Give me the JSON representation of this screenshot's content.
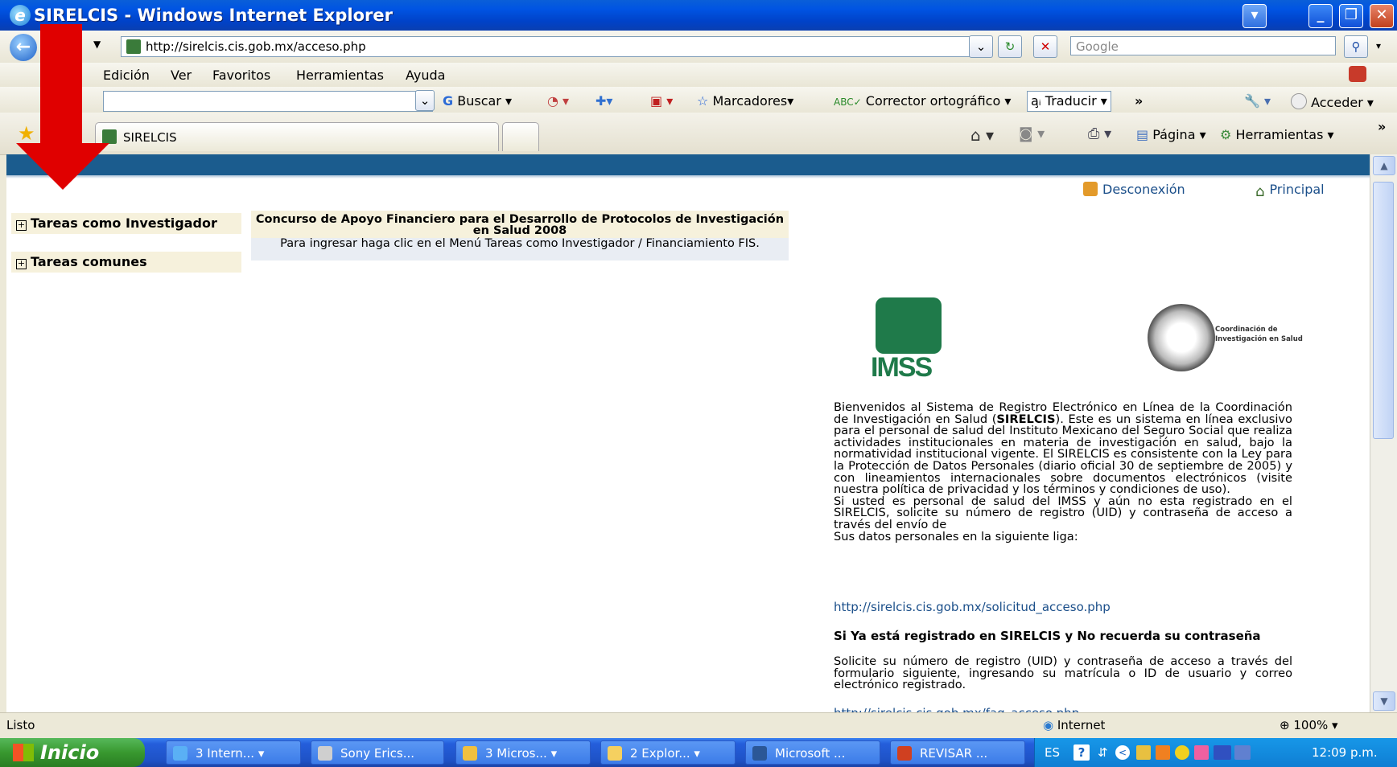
{
  "window": {
    "title": "SIRELCIS - Windows Internet Explorer"
  },
  "address": {
    "url": "http://sirelcis.cis.gob.mx/acceso.php"
  },
  "search": {
    "placeholder": "Google"
  },
  "menu": {
    "items": [
      "Edición",
      "Ver",
      "Favoritos",
      "Herramientas",
      "Ayuda"
    ]
  },
  "google_toolbar": {
    "buscar": "Buscar",
    "marcadores": "Marcadores",
    "corrector": "Corrector ortográfico",
    "traducir": "Traducir",
    "acceder": "Acceder",
    "more": "»"
  },
  "tabs": {
    "active": "SIRELCIS"
  },
  "command_bar": {
    "pagina": "Página",
    "herramientas": "Herramientas",
    "more": "»"
  },
  "page": {
    "desconexion": "Desconexión",
    "principal": "Principal",
    "sidebar": [
      "Tareas como Investigador",
      "Tareas comunes"
    ],
    "notice_title": "Concurso de Apoyo Financiero para el Desarrollo de Protocolos de Investigación en Salud 2008",
    "notice_body": "Para ingresar haga clic en el Menú Tareas como Investigador / Financiamiento FIS.",
    "logo_imss": "IMSS",
    "logo_cis": "Coordinación de Investigación en Salud",
    "welcome_a": "Bienvenidos al Sistema de Registro Electrónico en Línea de la Coordinación de Investigación en Salud (",
    "welcome_bold": "SIRELCIS",
    "welcome_b": "). Este es un sistema en línea exclusivo para el personal de salud del Instituto Mexicano del Seguro Social que realiza actividades institucionales en materia de investigación en salud, bajo la normatividad institucional vigente. El SIRELCIS es consistente con la Ley para la Protección de Datos Personales (diario oficial 30 de septiembre de 2005) y con lineamientos internacionales sobre documentos electrónicos (visite nuestra política de privacidad y los términos y condiciones de uso).",
    "welcome_c": "Si usted es personal de salud del IMSS y aún no esta registrado en el SIRELCIS, solicite su número de registro (UID) y contraseña de acceso a través del envío de",
    "welcome_d": "Sus datos personales en la siguiente liga:",
    "link1": "http://sirelcis.cis.gob.mx/solicitud_acceso.php",
    "heading2": "Si Ya está registrado en SIRELCIS y No recuerda su contraseña",
    "para2": "Solicite su número de registro (UID) y contraseña de acceso a través del formulario siguiente, ingresando su matrícula o ID de usuario y correo electrónico registrado.",
    "link2": "http://sirelcis.cis.gob.mx/faq_acceso.php"
  },
  "status": {
    "text": "Listo",
    "zone": "Internet",
    "zoom": "100%"
  },
  "taskbar": {
    "start": "Inicio",
    "buttons": [
      "3 Intern...",
      "Sony Erics...",
      "3 Micros...",
      "2 Explor...",
      "Microsoft ...",
      "REVISAR ..."
    ],
    "lang": "ES",
    "clock": "12:09 p.m."
  }
}
